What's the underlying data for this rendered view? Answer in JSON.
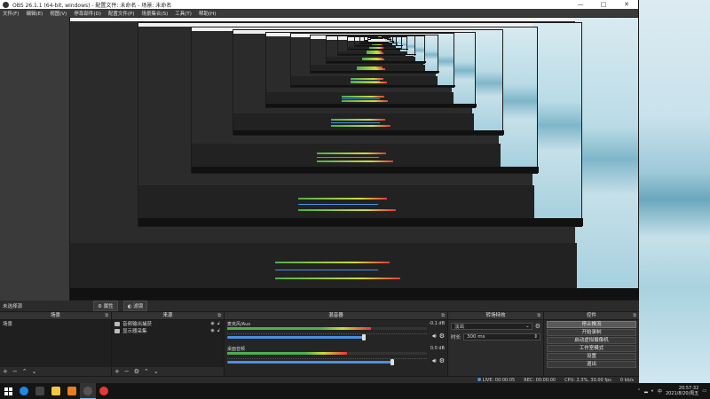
{
  "window": {
    "title": "OBS 26.1.1 (64-bit, windows) - 配置文件: 未命名 - 场景: 未命名",
    "controls": [
      "—",
      "□",
      "✕"
    ]
  },
  "menu": [
    "文件(F)",
    "编辑(E)",
    "视图(V)",
    "停靠部件(D)",
    "配置文件(P)",
    "场景集合(S)",
    "工具(T)",
    "帮助(H)"
  ],
  "scenebar": {
    "label": "未选择源",
    "properties": "属性",
    "filters": "滤镜"
  },
  "scenes": {
    "title": "场景",
    "items": [
      "场景"
    ]
  },
  "sources": {
    "title": "来源",
    "items": [
      "音频输出捕获",
      "显示器采集"
    ]
  },
  "mixer": {
    "title": "混音器",
    "channels": [
      {
        "name": "麦克风/Aux",
        "db": "-0.1 dB",
        "level": 0.72,
        "volume": 0.72
      },
      {
        "name": "桌面音频",
        "db": "0.0 dB",
        "level": 0.6,
        "volume": 0.85
      }
    ]
  },
  "transitions": {
    "title": "转场特效",
    "type": "淡出",
    "duration_label": "时长",
    "duration": "300 ms"
  },
  "controls": {
    "title": "控件",
    "buttons": [
      "停止推流",
      "开始录制",
      "启动虚拟摄像机",
      "工作室模式",
      "设置",
      "退出"
    ]
  },
  "status": {
    "live": "LIVE: 00:00:05",
    "rec": "REC: 00:00:00",
    "cpu": "CPU: 2.3%, 30.00 fps",
    "kb": "0 kb/s"
  },
  "tray": {
    "time": "20:57:32",
    "date": "2021/8/20/周五"
  },
  "colors": {
    "obs_bg": "#2b2b2b",
    "selection": "#3d5a80",
    "volume_blue": "#4a90e2",
    "meter_green": "#4caf50",
    "meter_yellow": "#cddc39",
    "meter_red": "#e53935"
  }
}
